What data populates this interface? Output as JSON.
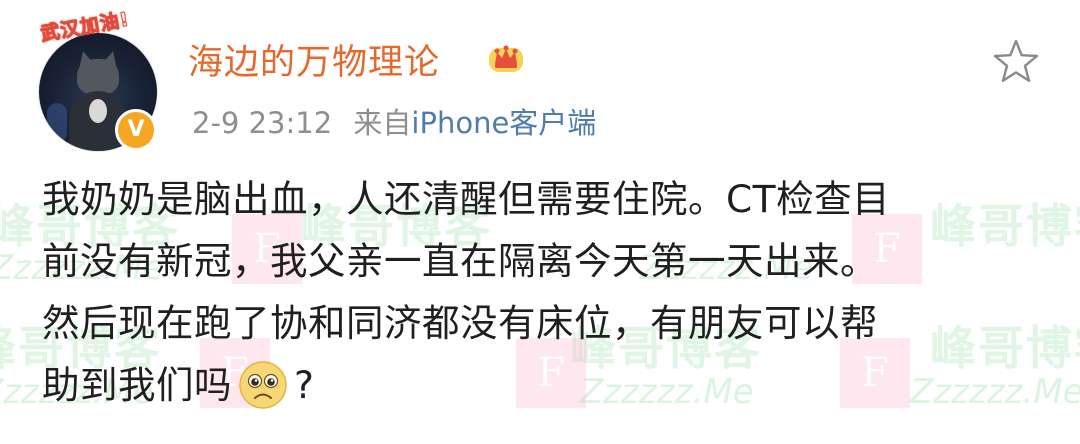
{
  "post": {
    "avatar_tag": "武汉加油!",
    "vip_badge": "V",
    "username": "海边的万物理论",
    "time": "2-9 23:12",
    "source_prefix": "来自",
    "source_client": "iPhone客户端",
    "content_lines": [
      "我奶奶是脑出血，人还清醒但需要住院。CT检查目",
      "前没有新冠，我父亲一直在隔离今天第一天出来。",
      "然后现在跑了协和同济都没有床位，有朋友可以帮"
    ],
    "content_last_before_emoji": "助到我们吗",
    "content_last_after_emoji": "?"
  },
  "icons": {
    "crown": "crown-icon",
    "star": "star-outline-icon",
    "emoji": "sad-pleading-face-emoji"
  },
  "colors": {
    "username": "#e6682c",
    "client_link": "#4f7cae",
    "meta": "#8e8e8e",
    "vip_badge": "#f5a623",
    "watermark_green": "#70d280",
    "watermark_pink": "#ffaac8"
  },
  "watermark": {
    "name": "峰哥博客",
    "domain": "Zzzzzz.Me",
    "logo_letter": "F"
  }
}
